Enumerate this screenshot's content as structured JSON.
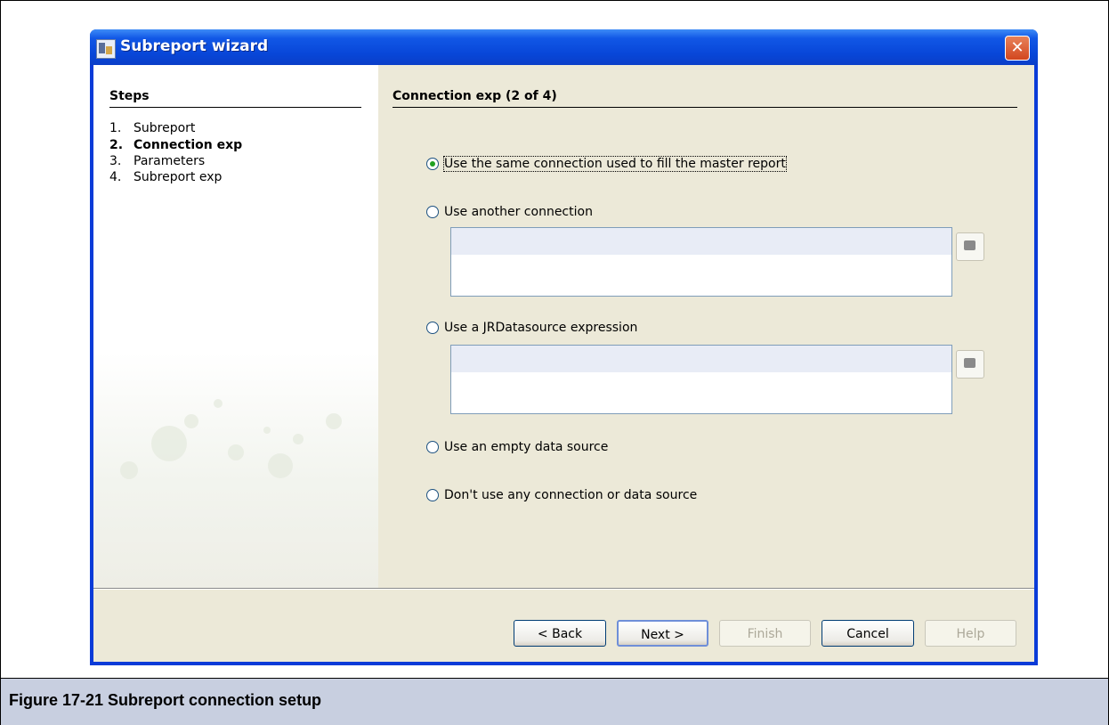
{
  "window": {
    "title": "Subreport wizard",
    "close_glyph": "✕"
  },
  "steps": {
    "title": "Steps",
    "items": [
      {
        "num": "1.",
        "label": "Subreport"
      },
      {
        "num": "2.",
        "label": "Connection exp"
      },
      {
        "num": "3.",
        "label": "Parameters"
      },
      {
        "num": "4.",
        "label": "Subreport exp"
      }
    ]
  },
  "content": {
    "title": "Connection exp (2 of 4)",
    "options": [
      {
        "label": "Use the same connection used to fill the master report",
        "checked": true
      },
      {
        "label": "Use another connection",
        "checked": false
      },
      {
        "label": "Use a JRDatasource expression",
        "checked": false
      },
      {
        "label": "Use an empty data source",
        "checked": false
      },
      {
        "label": "Don't use any connection or data source",
        "checked": false
      }
    ]
  },
  "buttons": {
    "back": "< Back",
    "next": "Next >",
    "finish": "Finish",
    "cancel": "Cancel",
    "help": "Help"
  },
  "caption": "Figure 17-21  Subreport connection setup"
}
